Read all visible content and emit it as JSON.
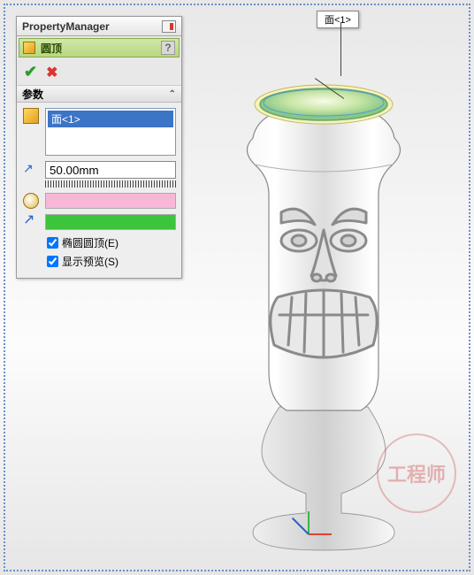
{
  "panel": {
    "title": "PropertyManager",
    "feature_title": "圆顶",
    "help_glyph": "?",
    "ok_glyph": "✔",
    "cancel_glyph": "✖"
  },
  "params": {
    "section_label": "参数",
    "collapse_glyph": "⌃",
    "face_selection": "面<1>",
    "distance": "50.00mm",
    "elliptical_dome": "椭圆圆顶(E)",
    "show_preview": "显示预览(S)"
  },
  "callout": {
    "label": "面<1>"
  },
  "watermark": "工程师"
}
